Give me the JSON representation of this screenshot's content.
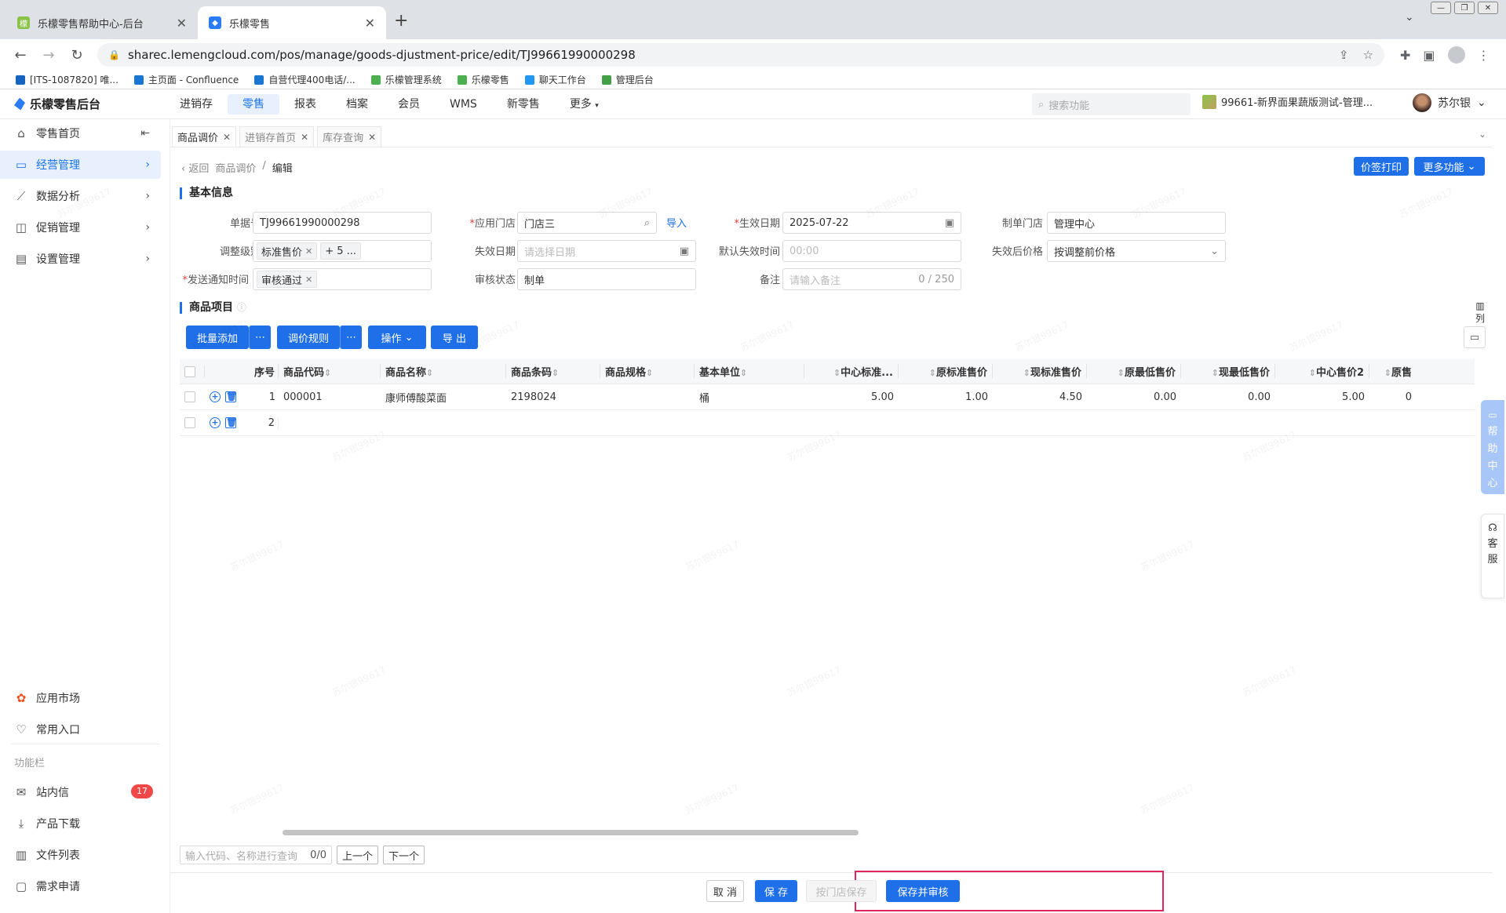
{
  "browser": {
    "tabs": [
      {
        "title": "乐檬零售帮助中心-后台",
        "active": false
      },
      {
        "title": "乐檬零售",
        "active": true
      }
    ],
    "new_tab": "+",
    "url": "sharec.lemengcloud.com/pos/manage/goods-djustment-price/edit/TJ99661990000298",
    "bookmarks": [
      {
        "label": "[ITS-1087820] 唯...",
        "color": "#1565c0"
      },
      {
        "label": "主页面 - Confluence",
        "color": "#1976d2"
      },
      {
        "label": "自营代理400电话/...",
        "color": "#1976d2"
      },
      {
        "label": "乐檬管理系统",
        "color": "#4caf50"
      },
      {
        "label": "乐檬零售",
        "color": "#4caf50"
      },
      {
        "label": "聊天工作台",
        "color": "#2196f3"
      },
      {
        "label": "管理后台",
        "color": "#43a047"
      }
    ]
  },
  "app": {
    "logo": "乐檬零售后台",
    "nav": [
      "进销存",
      "零售",
      "报表",
      "档案",
      "会员",
      "WMS",
      "新零售",
      "更多"
    ],
    "active_nav": "零售",
    "search_placeholder": "搜索功能",
    "store": "99661-新界面果蔬版测试-管理...",
    "user": "苏尔银"
  },
  "sidebar": {
    "items": [
      {
        "label": "零售首页",
        "icon": "home-icon"
      },
      {
        "label": "经营管理",
        "icon": "monitor-icon",
        "active": true
      },
      {
        "label": "数据分析",
        "icon": "chart-icon"
      },
      {
        "label": "促销管理",
        "icon": "promo-icon"
      },
      {
        "label": "设置管理",
        "icon": "folder-icon"
      }
    ],
    "bottom": [
      {
        "label": "应用市场",
        "icon": "app-market-icon"
      },
      {
        "label": "常用入口",
        "icon": "heart-icon"
      }
    ],
    "section_label": "功能栏",
    "func": [
      {
        "label": "站内信",
        "icon": "mail-icon",
        "badge": "17"
      },
      {
        "label": "产品下载",
        "icon": "download-icon"
      },
      {
        "label": "文件列表",
        "icon": "file-list-icon"
      },
      {
        "label": "需求申请",
        "icon": "request-icon"
      }
    ]
  },
  "page_tabs": [
    "商品调价",
    "进销存首页",
    "库存查询"
  ],
  "breadcrumb": {
    "back": "返回",
    "parent": "商品调价",
    "sep": "/",
    "current": "编辑"
  },
  "toolbar": {
    "print": "价签打印",
    "more": "更多功能"
  },
  "basic": {
    "title": "基本信息",
    "doc_no_label": "单据号",
    "doc_no": "TJ99661990000298",
    "store_label": "应用门店",
    "store": "门店三",
    "import": "导入",
    "eff_date_label": "生效日期",
    "eff_date": "2025-07-22",
    "make_store_label": "制单门店",
    "make_store": "管理中心",
    "level_label": "调整级别",
    "level_tag": "标准售价",
    "level_more": "+ 5 ...",
    "exp_date_label": "失效日期",
    "exp_date_ph": "请选择日期",
    "default_exp_time_label": "默认失效时间",
    "default_exp_time_ph": "00:00",
    "after_exp_label": "失效后价格",
    "after_exp": "按调整前价格",
    "notify_label": "发送通知时间",
    "notify_tag": "审核通过",
    "audit_label": "审核状态",
    "audit": "制单",
    "remark_label": "备注",
    "remark_ph": "请输入备注",
    "remark_count": "0 / 250"
  },
  "items": {
    "title": "商品项目",
    "buttons": {
      "batch_add": "批量添加",
      "rules": "调价规则",
      "ops": "操作",
      "export": "导 出"
    },
    "columns": [
      "序号",
      "商品代码",
      "商品名称",
      "商品条码",
      "商品规格",
      "基本单位",
      "中心标准...",
      "原标准售价",
      "现标准售价",
      "原最低售价",
      "现最低售价",
      "中心售价2",
      "原售"
    ],
    "rows": [
      {
        "seq": "1",
        "code": "000001",
        "name": "康师傅酸菜面",
        "barcode": "2198024",
        "spec": "",
        "unit": "桶",
        "center_std": "5.00",
        "orig_std": "1.00",
        "cur_std": "4.50",
        "orig_min": "0.00",
        "cur_min": "0.00",
        "center2": "5.00",
        "orig_x": "0"
      },
      {
        "seq": "2"
      }
    ],
    "column_toggle": "列"
  },
  "footer": {
    "search_ph": "输入代码、名称进行查询",
    "count": "0/0",
    "prev": "上一个",
    "next": "下一个"
  },
  "actions": {
    "cancel": "取 消",
    "save": "保 存",
    "save_by_store": "按门店保存",
    "save_audit": "保存并审核"
  },
  "float": {
    "help": [
      "帮",
      "助",
      "中",
      "心"
    ],
    "service": [
      "客",
      "服"
    ]
  },
  "watermark": "苏尔银99617",
  "window_controls": [
    "—",
    "❐",
    "✕"
  ]
}
